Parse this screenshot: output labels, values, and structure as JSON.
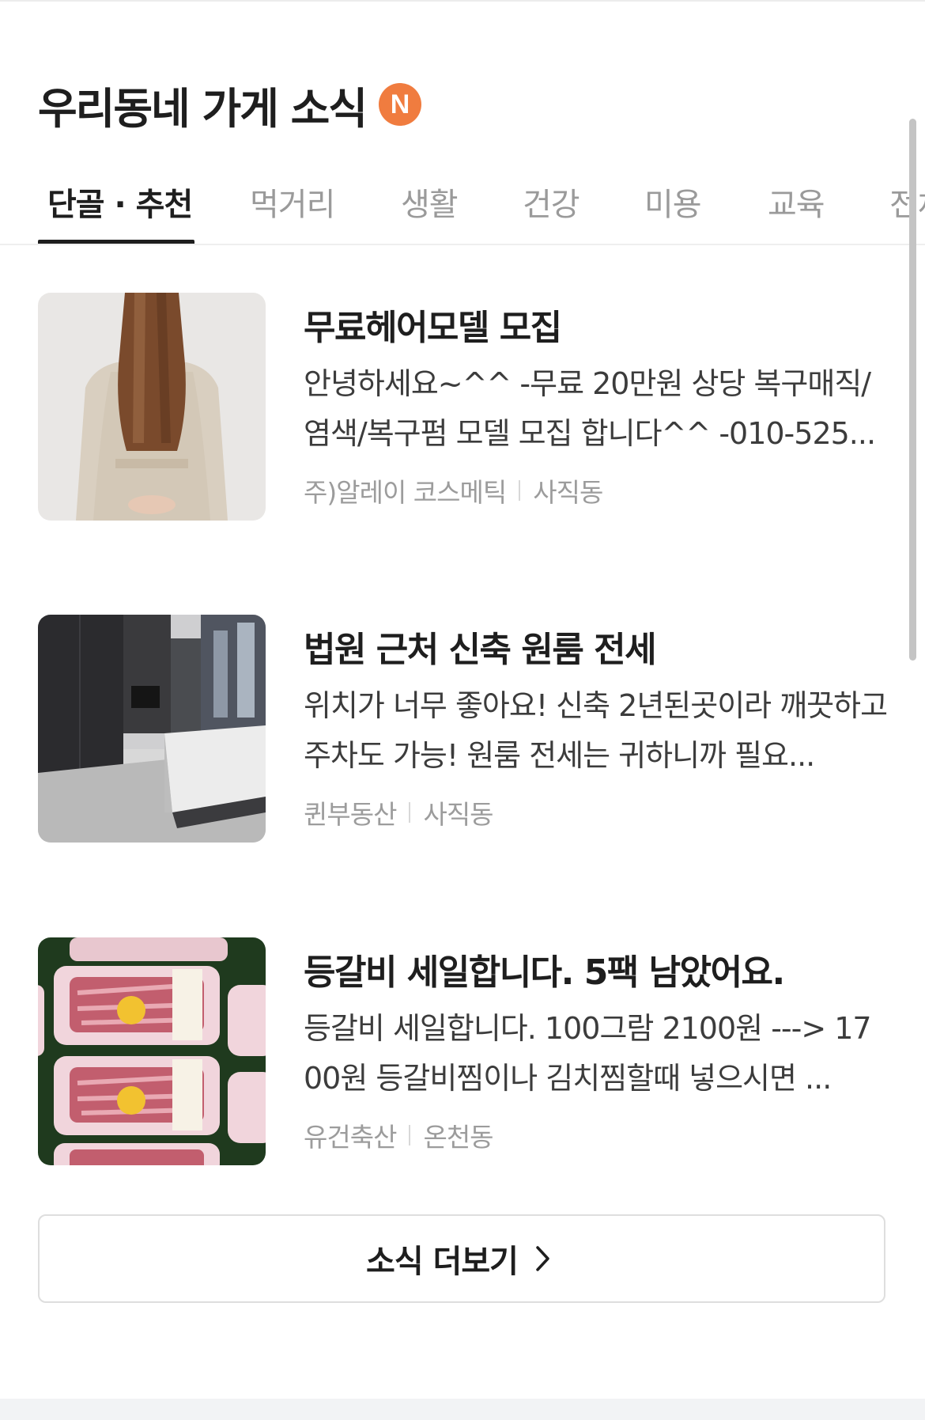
{
  "header": {
    "title": "우리동네 가게 소식",
    "new_badge": "N"
  },
  "tabs": [
    {
      "label": "단골 · 추천",
      "active": true
    },
    {
      "label": "먹거리",
      "active": false
    },
    {
      "label": "생활",
      "active": false
    },
    {
      "label": "건강",
      "active": false
    },
    {
      "label": "미용",
      "active": false
    },
    {
      "label": "교육",
      "active": false
    },
    {
      "label": "전체",
      "active": false
    }
  ],
  "posts": [
    {
      "title": "무료헤어모델 모집",
      "description": "안녕하세요~^^ -무료 20만원 상당 복구매직/염색/복구펌 모델 모집 합니다^^ -010-525...",
      "store": "주)알레이 코스메틱",
      "area": "사직동",
      "thumbnail": "hair-model-photo"
    },
    {
      "title": "법원 근처 신축 원룸 전세",
      "description": "위치가 너무 좋아요! 신축 2년된곳이라 깨끗하고 주차도 가능! 원룸 전세는 귀하니까 필요...",
      "store": "퀸부동산",
      "area": "사직동",
      "thumbnail": "studio-room-photo"
    },
    {
      "title": "등갈비 세일합니다. 5팩 남았어요.",
      "description": "등갈비 세일합니다. 100그람 2100원 ---> 1700원  등갈비찜이나 김치찜할때 넣으시면 ...",
      "store": "유건축산",
      "area": "온천동",
      "thumbnail": "pork-ribs-photo"
    }
  ],
  "more_button": {
    "label": "소식 더보기",
    "icon": "chevron-right-icon"
  },
  "colors": {
    "badge": "#f07c3f",
    "active_tab": "#1e1e1e",
    "inactive_tab": "#9a9a9a",
    "meta_text": "#9c9c9c"
  }
}
